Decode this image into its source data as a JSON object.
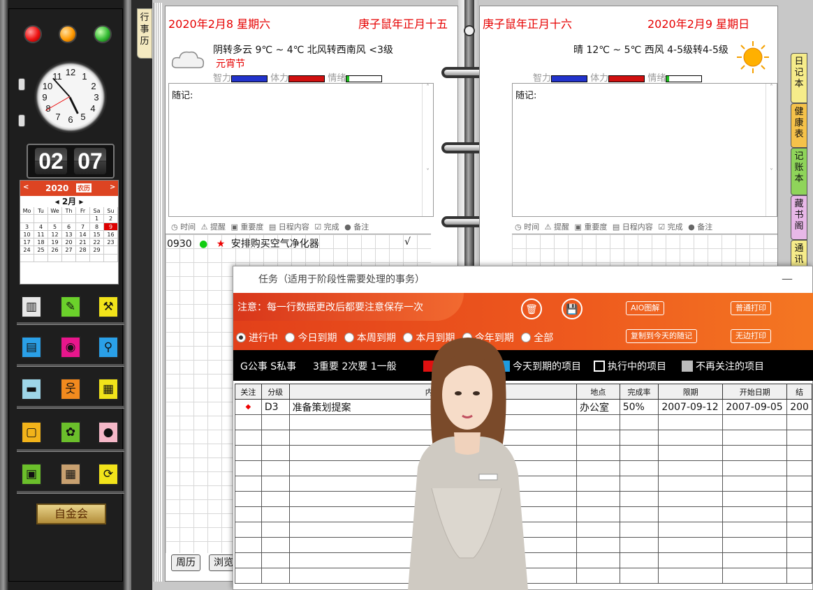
{
  "tabs": {
    "xingshi": "行事历",
    "right": [
      "日记本",
      "健康表",
      "记账本",
      "藏书阁",
      "通讯"
    ]
  },
  "clock": {
    "numbers": [
      "12",
      "1",
      "2",
      "3",
      "4",
      "5",
      "6",
      "7",
      "8",
      "9",
      "10",
      "11"
    ]
  },
  "flip": {
    "hour": "02",
    "minute": "07"
  },
  "calendar": {
    "year": "2020",
    "mode": "农历",
    "month": "2月",
    "prev": "<",
    "next": ">",
    "prev_m": "◂",
    "next_m": "▸",
    "weekdays": [
      "Mo",
      "Tu",
      "We",
      "Th",
      "Fr",
      "Sa",
      "Su"
    ],
    "cells": [
      "",
      "",
      "",
      "",
      "",
      "1",
      "2",
      "3",
      "4",
      "5",
      "6",
      "7",
      "8",
      "9",
      "10",
      "11",
      "12",
      "13",
      "14",
      "15",
      "16",
      "17",
      "18",
      "19",
      "20",
      "21",
      "22",
      "23",
      "24",
      "25",
      "26",
      "27",
      "28",
      "29",
      "",
      "",
      "",
      "",
      "",
      "",
      "",
      ""
    ],
    "today": "9"
  },
  "icon_names": [
    "scroll-icon",
    "pen-icon",
    "tools-icon",
    "notebook-icon",
    "compass-icon",
    "search-icon",
    "printer-icon",
    "people-icon",
    "memo-icon",
    "folder-icon",
    "turtle-icon",
    "globe-icon",
    "book-icon",
    "abacus-icon",
    "refresh-icon"
  ],
  "icon_glyphs": [
    "▥",
    "✎",
    "⚒",
    "▤",
    "◉",
    "⚲",
    "▬",
    "웃",
    "▦",
    "▢",
    "✿",
    "●",
    "▣",
    "▦",
    "⟳"
  ],
  "icon_colors": [
    "#e8e8e8",
    "#6bd12b",
    "#f2e31a",
    "#2aa0e8",
    "#e8168c",
    "#2aa0e8",
    "#9ed6e8",
    "#f28a1e",
    "#f2e31a",
    "#f2b31a",
    "#6bbf2b",
    "#f5b8c8",
    "#6bbf2b",
    "#c8a070",
    "#f2e31a"
  ],
  "shortcut": "自金会",
  "left_page": {
    "date": "2020年2月8 星期六",
    "lunar": "庚子鼠年正月十五",
    "weather": "阴转多云 9℃ ~ 4℃ 北风转西南风 <3级",
    "festival": "元宵节",
    "meter_labels": [
      "智力",
      "体力",
      "情绪"
    ],
    "notes_label": "随记:",
    "columns": [
      "◷ 时间",
      "⚠ 提醒",
      "▣ 重要度",
      "▤ 日程内容",
      "☑ 完成",
      "● 备注"
    ],
    "schedule": {
      "time": "0930",
      "dot": "●",
      "star": "★",
      "content": "安排购买空气净化器",
      "done": "√"
    },
    "buttons": [
      "周历",
      "浏览"
    ]
  },
  "right_page": {
    "lunar": "庚子鼠年正月十六",
    "date": "2020年2月9 星期日",
    "weather": "晴 12℃ ~ 5℃ 西风 4-5级转4-5级",
    "meter_labels": [
      "智力",
      "体力",
      "情绪"
    ],
    "notes_label": "随记:",
    "columns": [
      "◷ 时间",
      "⚠ 提醒",
      "▣ 重要度",
      "▤ 日程内容",
      "☑ 完成",
      "● 备注"
    ]
  },
  "dialog": {
    "title": "任务（适用于阶段性需要处理的事务）",
    "minimize": "—",
    "note": "注意：每一行数据更改后都要注意保存一次",
    "delete_icon": "🗑",
    "save_icon": "💾",
    "buttons": {
      "aio": "AIO图解",
      "copy": "复制到今天的随记",
      "print": "普通打印",
      "borderless": "无边打印"
    },
    "filters": [
      "进行中",
      "今日到期",
      "本周到期",
      "本月到期",
      "今年到期",
      "全部"
    ],
    "legend": {
      "category": "G公事 S私事",
      "priority": "3重要 2次要 1一般",
      "due_today": "今天到期的项目",
      "in_progress": "执行中的项目",
      "ignored": "不再关注的项目"
    },
    "columns": [
      "关注",
      "分级",
      "内容",
      "地点",
      "完成率",
      "限期",
      "开始日期",
      "结"
    ],
    "rows": [
      {
        "mark": "◆",
        "level": "D3",
        "content": "准备策划提案",
        "place": "办公室",
        "rate": "50%",
        "due": "2007-09-12",
        "start": "2007-09-05",
        "end": "200"
      }
    ]
  },
  "colors": {
    "accent_red": "#e60000",
    "dialog_orange": "#ee5a1e",
    "legend_red": "#e01010",
    "legend_blue": "#1e9be0"
  }
}
